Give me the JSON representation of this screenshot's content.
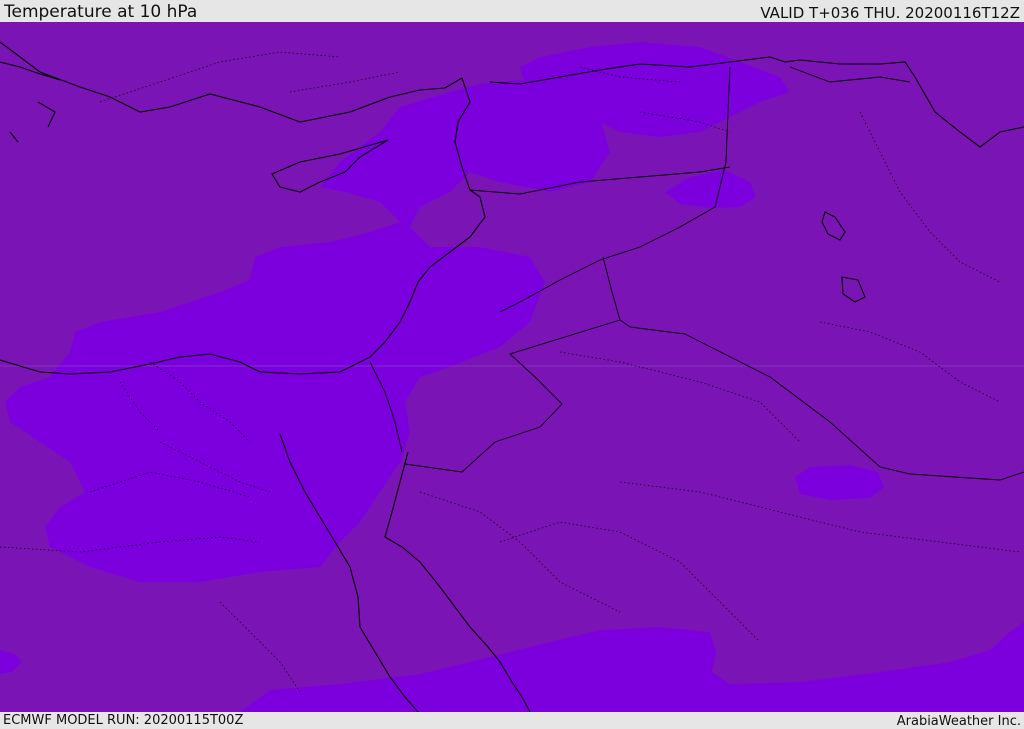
{
  "header": {
    "title": "Temperature at 10 hPa",
    "valid": "VALID T+036 THU. 20200116T12Z"
  },
  "footer": {
    "model_run": "ECMWF MODEL RUN: 20200115T00Z",
    "credit": "ArabiaWeather Inc."
  },
  "map": {
    "colors": {
      "background_band": "#7b14b4",
      "warmer_band": "#7c00de",
      "coastline": "#000000",
      "border": "#000000",
      "gridline": "#8a3cc0"
    }
  }
}
